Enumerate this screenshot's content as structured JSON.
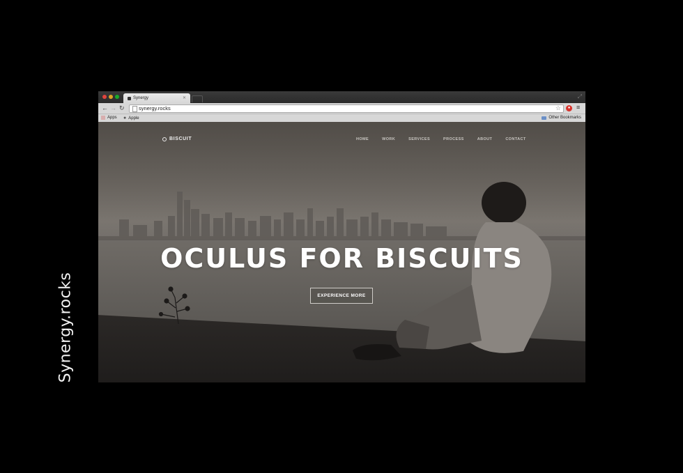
{
  "caption": "Synergy.rocks",
  "browser": {
    "tab_title": "Synergy",
    "url": "synergy.rocks",
    "bookmarks": [
      "Apps",
      "Apple"
    ],
    "other_bookmarks": "Other Bookmarks"
  },
  "site": {
    "logo": "BISCUIT",
    "nav": [
      "HOME",
      "WORK",
      "SERVICES",
      "PROCESS",
      "ABOUT",
      "CONTACT"
    ],
    "hero_title": "OCULUS FOR BISCUITS",
    "cta_label": "EXPERIENCE MORE"
  },
  "colors": {
    "background": "#000000",
    "hero_overlay": "#6b6660",
    "text": "#ffffff"
  },
  "icons": [
    "back-arrow-icon",
    "forward-arrow-icon",
    "reload-icon",
    "page-icon",
    "star-icon",
    "extension-icon",
    "menu-icon",
    "apps-icon",
    "apple-icon",
    "folder-icon",
    "logo-icon"
  ]
}
